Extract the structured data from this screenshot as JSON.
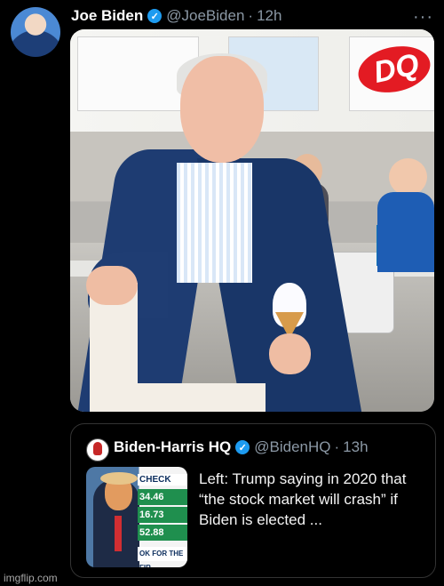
{
  "tweet": {
    "author": "Joe Biden",
    "handle": "@JoeBiden",
    "separator": "·",
    "age": "12h",
    "more": "···"
  },
  "photo": {
    "dq_logo": "DQ"
  },
  "quoted_tweet": {
    "author": "Biden-Harris HQ",
    "handle": "@BidenHQ",
    "separator": "·",
    "age": "13h",
    "text": "Left: Trump saying in 2020 that “the stock market will crash” if Biden is elected ...",
    "thumbnail": {
      "top_label": "CHECK",
      "ticker_1": "34.46",
      "ticker_2": "16.73",
      "ticker_3": "52.88",
      "bottom_label": "OK FOR THE FIR"
    }
  },
  "footer": {
    "watermark": "imgflip.com"
  }
}
